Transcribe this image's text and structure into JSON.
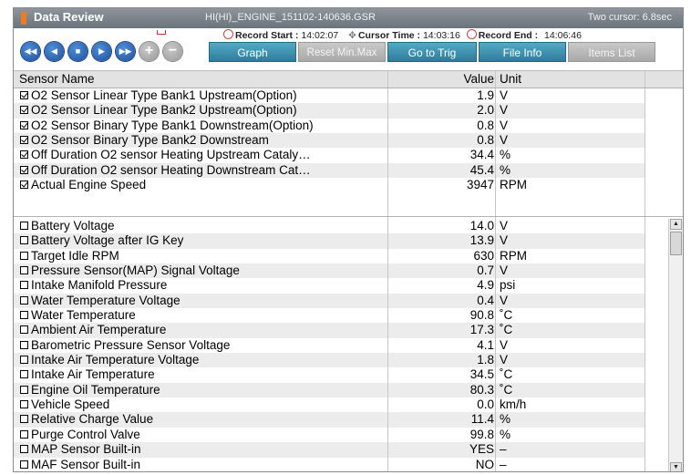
{
  "window": {
    "title": "Data Review",
    "file_name": "HI(HI)_ENGINE_151102-140636.GSR",
    "cursor_info": "Two cursor: 6.8sec"
  },
  "records": {
    "start_label": "Record Start :",
    "start_value": "14:02:07",
    "cursor_label": "Cursor Time :",
    "cursor_value": "14:03:16",
    "end_label": "Record End :",
    "end_value": "14:06:46"
  },
  "nav_icons": [
    "rewind-icon",
    "step-back-icon",
    "stop-icon",
    "play-icon",
    "fast-forward-icon",
    "zoom-in-icon",
    "zoom-out-icon"
  ],
  "toolbar": {
    "graph": "Graph",
    "reset": "Reset Min.Max",
    "go_to_trig": "Go to Trig",
    "file_info": "File Info",
    "items_list": "Items List"
  },
  "columns": {
    "name": "Sensor Name",
    "value": "Value",
    "unit": "Unit"
  },
  "selected_sensors": [
    {
      "name": "O2 Sensor Linear Type Bank1 Upstream(Option)",
      "value": "1.9",
      "unit": "V"
    },
    {
      "name": "O2 Sensor Linear Type Bank2 Upstream(Option)",
      "value": "2.0",
      "unit": "V"
    },
    {
      "name": "O2 Sensor Binary Type Bank1 Downstream(Option)",
      "value": "0.8",
      "unit": "V"
    },
    {
      "name": "O2 Sensor Binary Type Bank2 Downstream",
      "value": "0.8",
      "unit": "V"
    },
    {
      "name": "Off Duration O2 sensor Heating Upstream Cataly…",
      "value": "34.4",
      "unit": "%"
    },
    {
      "name": "Off Duration O2 sensor Heating Downstream Cat…",
      "value": "45.4",
      "unit": "%"
    },
    {
      "name": "Actual Engine Speed",
      "value": "3947",
      "unit": "RPM"
    }
  ],
  "other_sensors": [
    {
      "name": "Battery Voltage",
      "value": "14.0",
      "unit": "V"
    },
    {
      "name": "Battery Voltage after IG Key",
      "value": "13.9",
      "unit": "V"
    },
    {
      "name": "Target Idle RPM",
      "value": "630",
      "unit": "RPM"
    },
    {
      "name": "Pressure Sensor(MAP) Signal Voltage",
      "value": "0.7",
      "unit": "V"
    },
    {
      "name": "Intake Manifold Pressure",
      "value": "4.9",
      "unit": "psi"
    },
    {
      "name": "Water Temperature Voltage",
      "value": "0.4",
      "unit": "V"
    },
    {
      "name": "Water Temperature",
      "value": "90.8",
      "unit": "˚C"
    },
    {
      "name": "Ambient Air Temperature",
      "value": "17.3",
      "unit": "˚C"
    },
    {
      "name": "Barometric Pressure Sensor Voltage",
      "value": "4.1",
      "unit": "V"
    },
    {
      "name": "Intake Air Temperature Voltage",
      "value": "1.8",
      "unit": "V"
    },
    {
      "name": "Intake Air Temperature",
      "value": "34.5",
      "unit": "˚C"
    },
    {
      "name": "Engine Oil Temperature",
      "value": "80.3",
      "unit": "˚C"
    },
    {
      "name": "Vehicle Speed",
      "value": "0.0",
      "unit": "km/h"
    },
    {
      "name": "Relative Charge Value",
      "value": "11.4",
      "unit": "%"
    },
    {
      "name": "Purge Control Valve",
      "value": "99.8",
      "unit": "%"
    },
    {
      "name": "MAP Sensor Built-in",
      "value": "YES",
      "unit": "–"
    },
    {
      "name": "MAF Sensor Built-in",
      "value": "NO",
      "unit": "–"
    }
  ]
}
